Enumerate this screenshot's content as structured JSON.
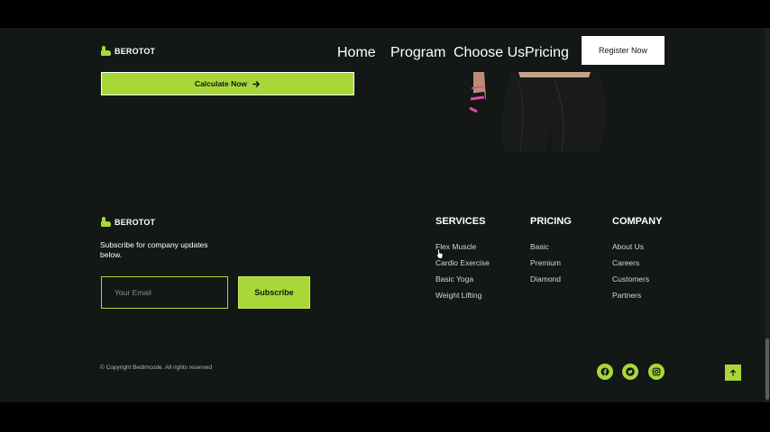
{
  "brand": {
    "name": "BEROTOT",
    "accent_color": "#a8d838",
    "background_color": "#131715"
  },
  "nav": {
    "items": [
      "Home",
      "Program",
      "Choose Us",
      "Pricing"
    ],
    "register_label": "Register Now"
  },
  "hero": {
    "calculate_label": "Calculate Now",
    "calculate_icon": "arrow-right-icon"
  },
  "footer": {
    "brand_name": "BEROTOT",
    "subscribe_text": "Subscribe for company updates below.",
    "email_placeholder": "Your Email",
    "subscribe_label": "Subscribe",
    "columns": [
      {
        "title": "SERVICES",
        "links": [
          "Flex Muscle",
          "Cardio Exercise",
          "Basic Yoga",
          "Weight Lifting"
        ]
      },
      {
        "title": "PRICING",
        "links": [
          "Basic",
          "Premium",
          "Diamond"
        ]
      },
      {
        "title": "COMPANY",
        "links": [
          "About Us",
          "Careers",
          "Customers",
          "Partners"
        ]
      }
    ],
    "copyright": "© Copyright Bedimcode. All rights reserved",
    "social_icons": [
      "facebook-icon",
      "twitter-icon",
      "instagram-icon"
    ],
    "scroll_top_icon": "arrow-up-icon"
  }
}
